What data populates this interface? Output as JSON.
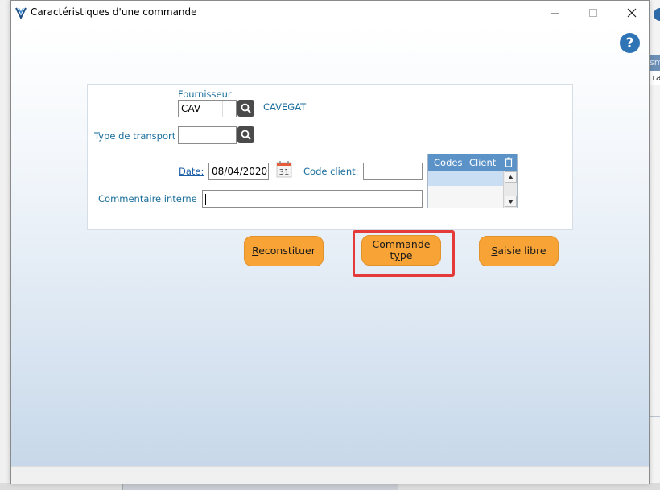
{
  "window": {
    "title": "Caractéristiques d'une commande"
  },
  "form": {
    "fournisseur_label": "Fournisseur",
    "fournisseur_code": "CAV",
    "fournisseur_name": "CAVEGAT",
    "transport_label": "Type de transport",
    "transport_value": "",
    "date_label": "Date:",
    "date_value": "08/04/2020",
    "calendar_day": "31",
    "code_client_label": "Code client:",
    "code_client_value": "",
    "commentaire_label": "Commentaire interne",
    "commentaire_value": ""
  },
  "grid": {
    "col1": "Codes",
    "col2": "Client"
  },
  "buttons": {
    "reconstituer_r": "R",
    "reconstituer_rest": "econstituer",
    "commande_line1": "Commande",
    "commande_line2_pre": "t",
    "commande_line2_u": "y",
    "commande_line2_post": "pe",
    "saisie_s": "S",
    "saisie_rest": "aisie libre"
  },
  "background": {
    "right_bar1_text": "sm",
    "right_bar2_text": "tra"
  },
  "colors": {
    "accent_button": "#f7a336",
    "label_blue": "#1a6e9c",
    "grid_header": "#5b92c8",
    "highlight": "#e43a3a",
    "help": "#2f74b5"
  }
}
